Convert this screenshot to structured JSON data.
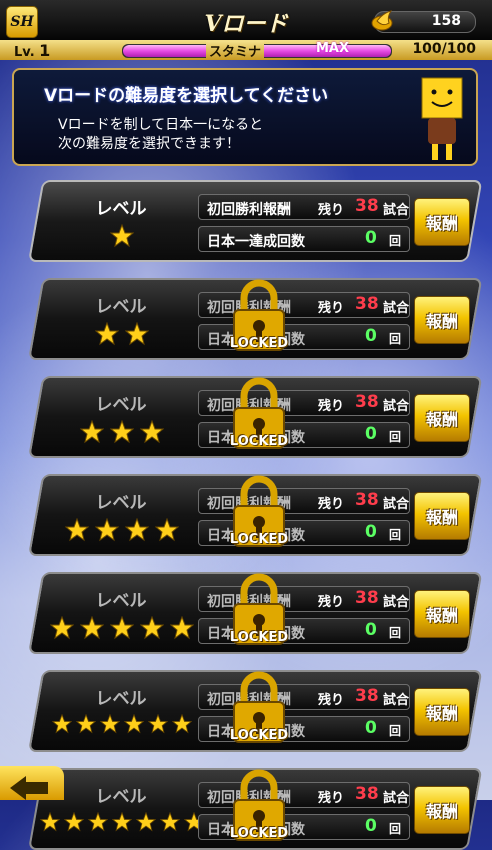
{
  "header": {
    "logo": "SH",
    "title": "Vロード",
    "coins": "158",
    "coin_icon": "pepper-coin-icon"
  },
  "status": {
    "level_prefix": "Lv.",
    "level": "1",
    "stamina_label": "スタミナ",
    "max_label": "MAX",
    "stamina_value": "100/100",
    "stamina_fraction": 1.0
  },
  "info": {
    "title": "Vロードの難易度を選択してください",
    "line1": "Vロードを制して日本一になると",
    "line2": "次の難易度を選択できます！"
  },
  "rows": [
    {
      "level_label": "レベル",
      "stars": 1,
      "first_win": "初回勝利報酬",
      "remaining": "残り",
      "games_left": "38",
      "games_unit": "試合",
      "champion": "日本一達成回数",
      "champion_count": "0",
      "count_unit": "回",
      "reward": "報酬",
      "locked": false
    },
    {
      "level_label": "レベル",
      "stars": 2,
      "first_win": "初回勝利報酬",
      "remaining": "残り",
      "games_left": "38",
      "games_unit": "試合",
      "champion": "日本一達成回数",
      "champion_count": "0",
      "count_unit": "回",
      "reward": "報酬",
      "locked": true,
      "lock_text": "LOCKED"
    },
    {
      "level_label": "レベル",
      "stars": 3,
      "first_win": "初回勝利報酬",
      "remaining": "残り",
      "games_left": "38",
      "games_unit": "試合",
      "champion": "日本一達成回数",
      "champion_count": "0",
      "count_unit": "回",
      "reward": "報酬",
      "locked": true,
      "lock_text": "LOCKED"
    },
    {
      "level_label": "レベル",
      "stars": 4,
      "first_win": "初回勝利報酬",
      "remaining": "残り",
      "games_left": "38",
      "games_unit": "試合",
      "champion": "日本一達成回数",
      "champion_count": "0",
      "count_unit": "回",
      "reward": "報酬",
      "locked": true,
      "lock_text": "LOCKED"
    },
    {
      "level_label": "レベル",
      "stars": 5,
      "first_win": "初回勝利報酬",
      "remaining": "残り",
      "games_left": "38",
      "games_unit": "試合",
      "champion": "日本一達成回数",
      "champion_count": "0",
      "count_unit": "回",
      "reward": "報酬",
      "locked": true,
      "lock_text": "LOCKED"
    },
    {
      "level_label": "レベル",
      "stars": 6,
      "first_win": "初回勝利報酬",
      "remaining": "残り",
      "games_left": "38",
      "games_unit": "試合",
      "champion": "日本一達成回数",
      "champion_count": "0",
      "count_unit": "回",
      "reward": "報酬",
      "locked": true,
      "lock_text": "LOCKED"
    },
    {
      "level_label": "レベル",
      "stars": 7,
      "first_win": "初回勝利報酬",
      "remaining": "残り",
      "games_left": "38",
      "games_unit": "試合",
      "champion": "日本一達成回数",
      "champion_count": "0",
      "count_unit": "回",
      "reward": "報酬",
      "locked": true,
      "lock_text": "LOCKED"
    }
  ],
  "colors": {
    "games_left": "#ff3d4c",
    "champion_count": "#5bff64",
    "reward_button": "#f3c300"
  }
}
